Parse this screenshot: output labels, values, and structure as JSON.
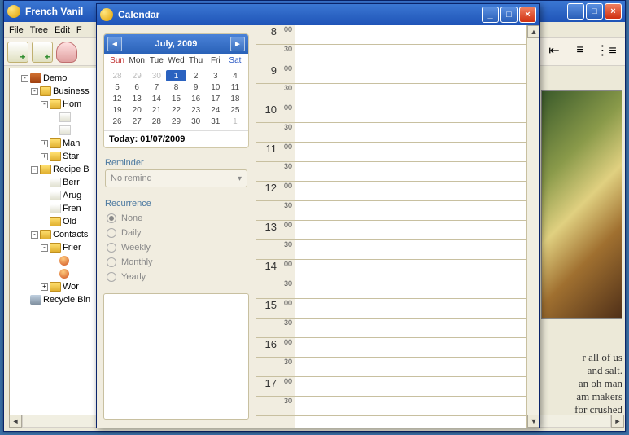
{
  "back_window": {
    "title": "French Vanil",
    "menus": [
      "File",
      "Tree",
      "Edit",
      "F"
    ]
  },
  "tree": {
    "root": "Demo",
    "items": [
      {
        "depth": 1,
        "exp": "-",
        "icon": "briefcase",
        "label": "Demo"
      },
      {
        "depth": 2,
        "exp": "-",
        "icon": "folder",
        "label": "Business"
      },
      {
        "depth": 3,
        "exp": "-",
        "icon": "folder",
        "label": "Hom"
      },
      {
        "depth": 4,
        "exp": "",
        "icon": "page",
        "label": ""
      },
      {
        "depth": 4,
        "exp": "",
        "icon": "page",
        "label": ""
      },
      {
        "depth": 3,
        "exp": "+",
        "icon": "folder",
        "label": "Man"
      },
      {
        "depth": 3,
        "exp": "+",
        "icon": "folder",
        "label": "Star"
      },
      {
        "depth": 2,
        "exp": "-",
        "icon": "folder",
        "label": "Recipe B"
      },
      {
        "depth": 3,
        "exp": "",
        "icon": "page",
        "label": "Berr"
      },
      {
        "depth": 3,
        "exp": "",
        "icon": "page",
        "label": "Arug"
      },
      {
        "depth": 3,
        "exp": "",
        "icon": "page",
        "label": "Fren"
      },
      {
        "depth": 3,
        "exp": "",
        "icon": "folder",
        "label": "Old"
      },
      {
        "depth": 2,
        "exp": "-",
        "icon": "folder",
        "label": "Contacts"
      },
      {
        "depth": 3,
        "exp": "-",
        "icon": "folder",
        "label": "Frier"
      },
      {
        "depth": 4,
        "exp": "",
        "icon": "user",
        "label": ""
      },
      {
        "depth": 4,
        "exp": "",
        "icon": "user",
        "label": ""
      },
      {
        "depth": 3,
        "exp": "+",
        "icon": "folder",
        "label": "Wor"
      },
      {
        "depth": 1,
        "exp": "",
        "icon": "bin",
        "label": "Recycle Bin"
      }
    ]
  },
  "fragment_lines": [
    "r all of us",
    "and salt.",
    "an oh man",
    "am makers",
    "for crushed"
  ],
  "calendar": {
    "title": "Calendar",
    "month_label": "July, 2009",
    "dow": [
      "Sun",
      "Mon",
      "Tue",
      "Wed",
      "Thu",
      "Fri",
      "Sat"
    ],
    "grid": [
      [
        {
          "n": 28,
          "o": true
        },
        {
          "n": 29,
          "o": true
        },
        {
          "n": 30,
          "o": true
        },
        {
          "n": 1,
          "today": true
        },
        {
          "n": 2
        },
        {
          "n": 3
        },
        {
          "n": 4
        }
      ],
      [
        {
          "n": 5
        },
        {
          "n": 6
        },
        {
          "n": 7
        },
        {
          "n": 8
        },
        {
          "n": 9
        },
        {
          "n": 10
        },
        {
          "n": 11
        }
      ],
      [
        {
          "n": 12
        },
        {
          "n": 13
        },
        {
          "n": 14
        },
        {
          "n": 15
        },
        {
          "n": 16
        },
        {
          "n": 17
        },
        {
          "n": 18
        }
      ],
      [
        {
          "n": 19
        },
        {
          "n": 20
        },
        {
          "n": 21
        },
        {
          "n": 22
        },
        {
          "n": 23
        },
        {
          "n": 24
        },
        {
          "n": 25
        }
      ],
      [
        {
          "n": 26
        },
        {
          "n": 27
        },
        {
          "n": 28
        },
        {
          "n": 29
        },
        {
          "n": 30
        },
        {
          "n": 31
        },
        {
          "n": 1,
          "o": true
        }
      ]
    ],
    "today_label": "Today: 01/07/2009",
    "reminder_label": "Reminder",
    "reminder_value": "No remind",
    "recurrence_label": "Recurrence",
    "recurrence_options": [
      "None",
      "Daily",
      "Weekly",
      "Monthly",
      "Yearly"
    ],
    "recurrence_selected": 0,
    "time_slots": [
      {
        "h": "8",
        "m": "00"
      },
      {
        "h": "",
        "m": "30"
      },
      {
        "h": "9",
        "m": "00"
      },
      {
        "h": "",
        "m": "30"
      },
      {
        "h": "10",
        "m": "00"
      },
      {
        "h": "",
        "m": "30"
      },
      {
        "h": "11",
        "m": "00"
      },
      {
        "h": "",
        "m": "30"
      },
      {
        "h": "12",
        "m": "00"
      },
      {
        "h": "",
        "m": "30"
      },
      {
        "h": "13",
        "m": "00"
      },
      {
        "h": "",
        "m": "30"
      },
      {
        "h": "14",
        "m": "00"
      },
      {
        "h": "",
        "m": "30"
      },
      {
        "h": "15",
        "m": "00"
      },
      {
        "h": "",
        "m": "30"
      },
      {
        "h": "16",
        "m": "00"
      },
      {
        "h": "",
        "m": "30"
      },
      {
        "h": "17",
        "m": "00"
      },
      {
        "h": "",
        "m": "30"
      }
    ]
  }
}
